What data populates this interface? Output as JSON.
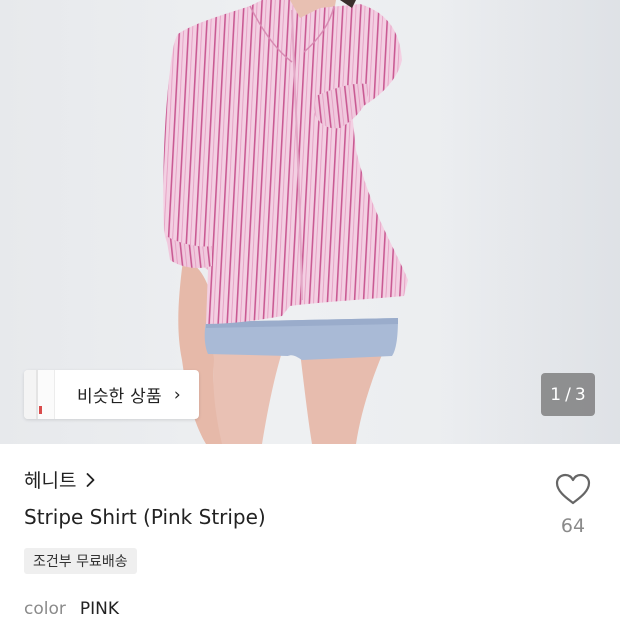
{
  "gallery": {
    "similar_label": "비슷한 상품",
    "similar_chevron": "›",
    "page_current": "1",
    "page_separator": "/",
    "page_total": "3"
  },
  "product": {
    "brand": "헤니트",
    "title": "Stripe Shirt (Pink Stripe)",
    "shipping_badge": "조건부 무료배송",
    "option_key": "color",
    "option_value": "PINK"
  },
  "like": {
    "count": "64",
    "icon": "heart-outline-icon"
  },
  "colors": {
    "shirt": "#f1c6de",
    "stripe": "#cf5f98",
    "shorts": "#a9bad6"
  }
}
